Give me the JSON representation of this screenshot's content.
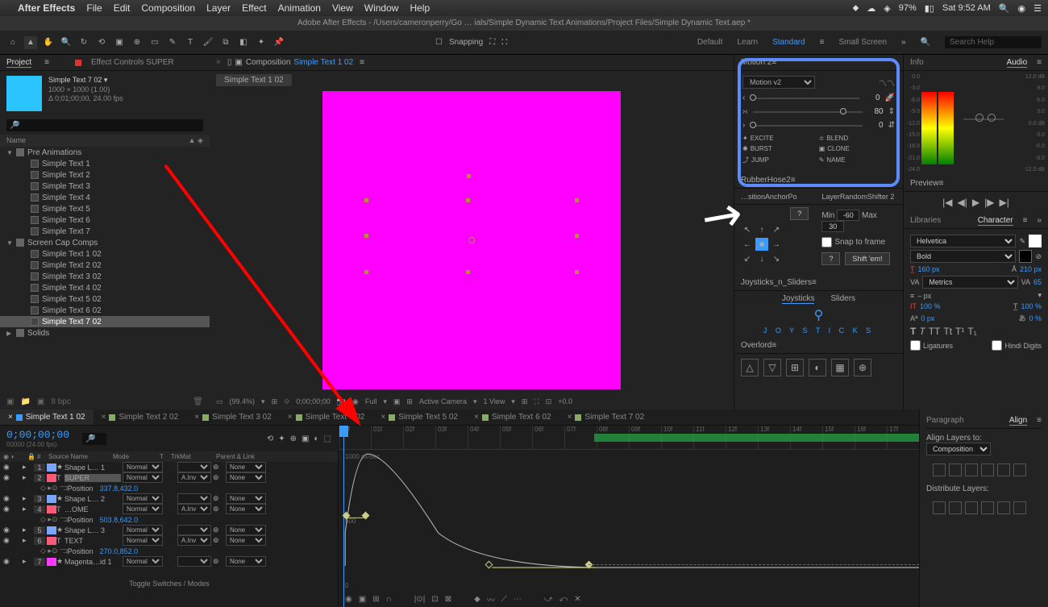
{
  "menu": {
    "apple": "",
    "app": "After Effects",
    "items": [
      "File",
      "Edit",
      "Composition",
      "Layer",
      "Effect",
      "Animation",
      "View",
      "Window",
      "Help"
    ],
    "battery": "97%",
    "clock": "Sat 9:52 AM"
  },
  "titlebar": "Adobe After Effects - /Users/cameronperry/Go … ials/Simple Dynamic Text Animations/Project Files/Simple Dynamic Text.aep *",
  "toolbar": {
    "snapping": "Snapping",
    "ws": [
      "Default",
      "Learn",
      "Standard",
      "Small Screen"
    ],
    "active_ws": "Standard",
    "search_ph": "Search Help"
  },
  "project": {
    "tab": "Project",
    "fxTab": "Effect Controls SUPER",
    "compName": "Simple Text 7 02 ▾",
    "size": "1000 × 1000 (1.00)",
    "dur": "Δ 0;01;00;00, 24.00 fps",
    "nameCol": "Name",
    "tree": [
      {
        "t": "folder",
        "n": "Pre Animations",
        "lvl": 0,
        "open": true
      },
      {
        "t": "comp",
        "n": "Simple Text 1",
        "lvl": 1
      },
      {
        "t": "comp",
        "n": "Simple Text 2",
        "lvl": 1
      },
      {
        "t": "comp",
        "n": "Simple Text 3",
        "lvl": 1
      },
      {
        "t": "comp",
        "n": "Simple Text 4",
        "lvl": 1
      },
      {
        "t": "comp",
        "n": "Simple Text 5",
        "lvl": 1
      },
      {
        "t": "comp",
        "n": "Simple Text 6",
        "lvl": 1
      },
      {
        "t": "comp",
        "n": "Simple Text 7",
        "lvl": 1
      },
      {
        "t": "folder",
        "n": "Screen Cap Comps",
        "lvl": 0,
        "open": true
      },
      {
        "t": "comp",
        "n": "Simple Text 1 02",
        "lvl": 1
      },
      {
        "t": "comp",
        "n": "Simple Text 2 02",
        "lvl": 1
      },
      {
        "t": "comp",
        "n": "Simple Text 3 02",
        "lvl": 1
      },
      {
        "t": "comp",
        "n": "Simple Text 4 02",
        "lvl": 1
      },
      {
        "t": "comp",
        "n": "Simple Text 5 02",
        "lvl": 1
      },
      {
        "t": "comp",
        "n": "Simple Text 6 02",
        "lvl": 1
      },
      {
        "t": "comp",
        "n": "Simple Text 7 02",
        "lvl": 1,
        "sel": true
      },
      {
        "t": "folder",
        "n": "Solids",
        "lvl": 0,
        "open": false
      }
    ]
  },
  "viewer": {
    "compLabel": "Composition",
    "compName": "Simple Text 1 02",
    "subTab": "Simple Text 1 02",
    "footer": {
      "zoom": "(99.4%)",
      "tc": "0;00;00;00",
      "res": "Full",
      "cam": "Active Camera",
      "views": "1 View",
      "exp": "+0.0"
    }
  },
  "motion": {
    "title": "Motion 2",
    "preset": "Motion v2",
    "v1": "0",
    "v2": "80",
    "v3": "0",
    "btns": [
      "EXCITE",
      "BLEND",
      "BURST",
      "CLONE",
      "JUMP",
      "NAME"
    ]
  },
  "rubber": {
    "title": "RubberHose2"
  },
  "posAnchor": {
    "title": "…sitionAnchorPo",
    "q": "?"
  },
  "layerShift": {
    "title": "LayerRandomShifter 2",
    "minL": "Min",
    "min": "-60",
    "maxL": "Max",
    "max": "30",
    "snap": "Snap to frame",
    "q": "?",
    "shift": "Shift 'em!"
  },
  "jns": {
    "title": "Joysticks_n_Sliders",
    "t1": "Joysticks",
    "t2": "Sliders",
    "logo": "J O Y S T I C K S"
  },
  "overlord": {
    "title": "Overlord"
  },
  "info": {
    "title": "Info"
  },
  "audio": {
    "title": "Audio",
    "scaleL": [
      "0.0",
      "-3.0",
      "-6.0",
      "-9.0",
      "-12.0",
      "-15.0",
      "-18.0",
      "-21.0",
      "-24.0"
    ],
    "scaleR": [
      "12.0 dB",
      "9.0",
      "6.0",
      "3.0",
      "0.0 dB",
      "-3.0",
      "-6.0",
      "-9.0",
      "-12.0 dB"
    ]
  },
  "preview": {
    "title": "Preview"
  },
  "libchar": {
    "lib": "Libraries",
    "char": "Character",
    "font": "Helvetica",
    "weight": "Bold",
    "size": "160 px",
    "lead": "210 px",
    "kernType": "Metrics",
    "track": "65",
    "pxUnit": "– px",
    "vs": "100 %",
    "hs": "100 %",
    "bl": "0 px",
    "tsu": "0 %",
    "lig": "Ligatures",
    "hindi": "Hindi Digits"
  },
  "paraAlign": {
    "para": "Paragraph",
    "align": "Align",
    "alignTo": "Align Layers to:",
    "alignTarget": "Composition",
    "dist": "Distribute Layers:"
  },
  "timeline": {
    "tabs": [
      "Simple Text 1 02",
      "Simple Text 2 02",
      "Simple Text 3 02",
      "Simple Text 4 02",
      "Simple Text 5 02",
      "Simple Text 6 02",
      "Simple Text 7 02"
    ],
    "activeTab": 0,
    "tc": "0;00;00;00",
    "tcSub": "00000 (24.00 fps)",
    "cols": {
      "src": "Source Name",
      "mode": "Mode",
      "trk": "TrkMat",
      "parent": "Parent & Link"
    },
    "frames": [
      "00f",
      "01f",
      "02f",
      "03f",
      "04f",
      "05f",
      "06f",
      "07f",
      "08f",
      "09f",
      "10f",
      "11f",
      "12f",
      "13f",
      "14f",
      "15f",
      "16f",
      "17f"
    ],
    "layers": [
      {
        "n": "1",
        "col": "#7aa6ff",
        "name": "Shape L… 1",
        "mode": "Normal",
        "trk": "",
        "parent": "None"
      },
      {
        "n": "2",
        "col": "#ff5a7a",
        "name": "SUPER",
        "mode": "Normal",
        "trk": "A.Inv",
        "parent": "None",
        "selName": true,
        "prop": {
          "name": "Position",
          "val": "337.8,432.0"
        }
      },
      {
        "n": "3",
        "col": "#7aa6ff",
        "name": "Shape L… 2",
        "mode": "Normal",
        "trk": "",
        "parent": "None"
      },
      {
        "n": "4",
        "col": "#ff5a7a",
        "name": "…OME",
        "mode": "Normal",
        "trk": "A.Inv",
        "parent": "None",
        "prop": {
          "name": "Position",
          "val": "503.8,642.0"
        }
      },
      {
        "n": "5",
        "col": "#7aa6ff",
        "name": "Shape L… 3",
        "mode": "Normal",
        "trk": "",
        "parent": "None"
      },
      {
        "n": "6",
        "col": "#ff5a7a",
        "name": "TEXT",
        "mode": "Normal",
        "trk": "A.Inv",
        "parent": "None",
        "prop": {
          "name": "Position",
          "val": "270.0,852.0"
        }
      },
      {
        "n": "7",
        "col": "#ff3aff",
        "name": "Magenta…id 1",
        "mode": "Normal",
        "trk": "",
        "parent": "None"
      }
    ],
    "graphLabels": {
      "top": "1000 px/sec",
      "mid": "500",
      "bot": "0"
    },
    "toggle": "Toggle Switches / Modes",
    "bpc": "8 bpc"
  }
}
